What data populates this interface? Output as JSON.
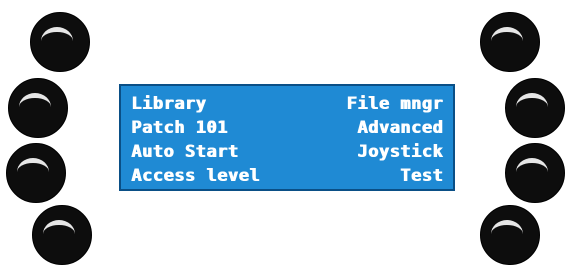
{
  "display": {
    "rows": [
      {
        "left": "Library",
        "right": "File mngr"
      },
      {
        "left": "Patch 101",
        "right": "Advanced"
      },
      {
        "left": "Auto Start",
        "right": "Joystick"
      },
      {
        "left": "Access level",
        "right": "Test"
      }
    ]
  },
  "colors": {
    "lcd_background": "#1f8ad4",
    "lcd_text": "#ffffff",
    "knob": "#0d0d0d",
    "knob_highlight": "#e6e6e6"
  },
  "icons": {
    "knob": "rotary-knob-icon"
  }
}
